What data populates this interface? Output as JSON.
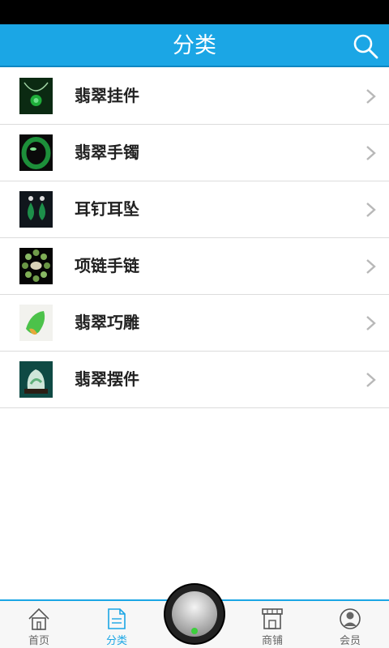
{
  "header": {
    "title": "分类",
    "search_icon": "search-icon"
  },
  "categories": [
    {
      "label": "翡翠挂件",
      "icon": "pendant-thumbnail"
    },
    {
      "label": "翡翠手镯",
      "icon": "bracelet-thumbnail"
    },
    {
      "label": "耳钉耳坠",
      "icon": "earring-thumbnail"
    },
    {
      "label": "项链手链",
      "icon": "necklace-thumbnail"
    },
    {
      "label": "翡翠巧雕",
      "icon": "carving-thumbnail"
    },
    {
      "label": "翡翠摆件",
      "icon": "ornament-thumbnail"
    }
  ],
  "tabbar": {
    "items": [
      {
        "label": "首页",
        "icon": "home-icon"
      },
      {
        "label": "分类",
        "icon": "category-icon",
        "active": true
      },
      {
        "label": "商铺",
        "icon": "shop-icon"
      },
      {
        "label": "会员",
        "icon": "member-icon"
      }
    ]
  },
  "colors": {
    "accent": "#1ba6e5",
    "status_bar": "#000000",
    "divider": "#dcdcdc"
  }
}
